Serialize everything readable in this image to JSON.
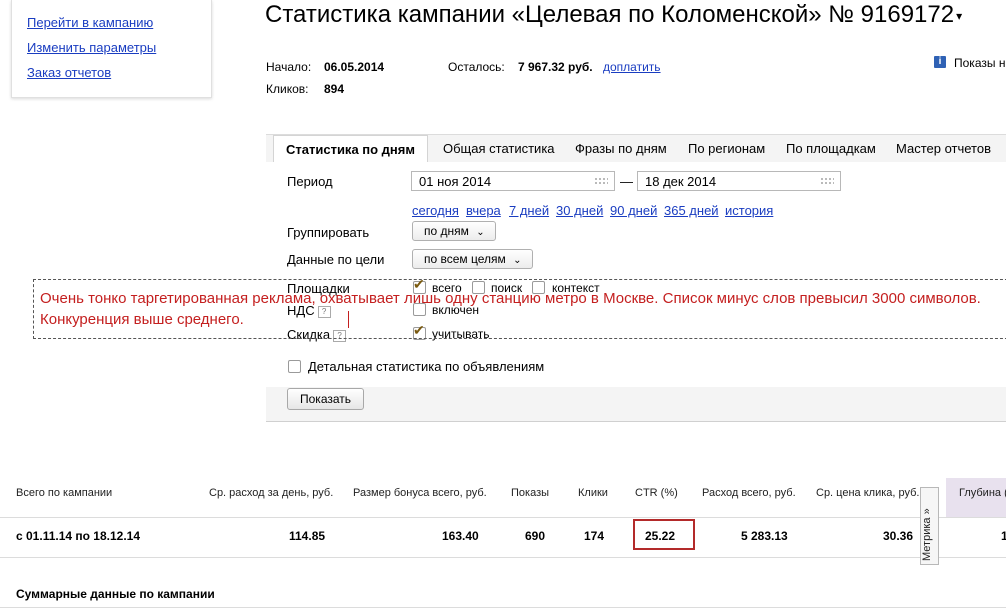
{
  "menu": {
    "items": [
      "Перейти в кампанию",
      "Изменить параметры",
      "Заказ отчетов"
    ]
  },
  "title": {
    "text": "Статистика кампании «Целевая по Коломенской» № 9169172",
    "caret": "▾"
  },
  "info": {
    "start_label": "Начало:",
    "start_value": "06.05.2014",
    "clicks_label": "Кликов:",
    "clicks_value": "894",
    "remain_label": "Осталось:",
    "remain_value": "7 967.32 руб.",
    "topup_link": "доплатить",
    "show_label": "Показы н"
  },
  "tabs": [
    "Статистика по дням",
    "Общая статистика",
    "Фразы по дням",
    "По регионам",
    "По площадкам",
    "Мастер отчетов"
  ],
  "form": {
    "period_label": "Период",
    "date_from": "01 ноя 2014",
    "date_sep": "—",
    "date_to": "18 дек 2014",
    "quick_links": [
      "сегодня",
      "вчера",
      "7 дней",
      "30 дней",
      "90 дней",
      "365 дней",
      "история"
    ],
    "group_label": "Группировать",
    "group_value": "по дням",
    "goal_label": "Данные по цели",
    "goal_value": "по всем целям",
    "sites_label": "Площадки",
    "site_all": "всего",
    "site_search": "поиск",
    "site_context": "контекст",
    "vat_label": "НДС",
    "vat_value": "включен",
    "discount_label": "Скидка",
    "discount_value": "учитывать",
    "detail_label": "Детальная статистика по объявлениям",
    "show_button": "Показать"
  },
  "note": {
    "text": "Очень тонко таргетированная реклама, охватывает лишь одну станцию метро в Москве. Список минус слов превысил 3000 символов. Конкуренция выше среднего.",
    "color": "#c41f1f"
  },
  "table": {
    "headers": [
      "Всего по кампании",
      "Ср. расход за день, руб.",
      "Размер бонуса всего, руб.",
      "Показы",
      "Клики",
      "CTR (%)",
      "Расход всего, руб.",
      "Ср. цена клика, руб.",
      "Глубина ("
    ],
    "row": [
      "с 01.11.14 по 18.12.14",
      "114.85",
      "163.40",
      "690",
      "174",
      "25.22",
      "5 283.13",
      "30.36",
      "1"
    ],
    "metrika_label": "Метрика »"
  },
  "summary_title": "Суммарные данные по кампании"
}
